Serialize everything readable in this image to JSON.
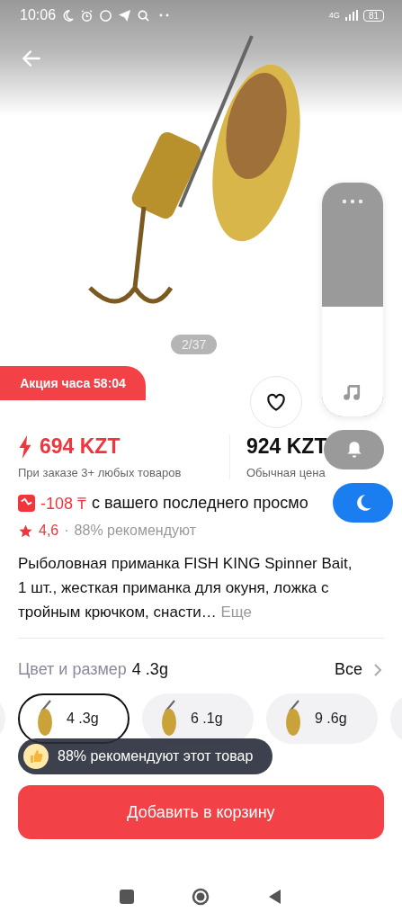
{
  "status_bar": {
    "time": "10:06",
    "network": "4G",
    "battery": "81"
  },
  "gallery": {
    "counter": "2/37"
  },
  "promo": {
    "label": "Акция часа",
    "timer": "58:04"
  },
  "favorite": {
    "selected": false
  },
  "price": {
    "sale": "694 KZT",
    "sale_note": "При заказе 3+ любых товаров",
    "regular": "924 KZT",
    "regular_note": "Обычная цена"
  },
  "price_drop": {
    "amount": "-108 ₸",
    "text": "с вашего последнего просмо"
  },
  "rating": {
    "score": "4,6",
    "separator": "·",
    "recommend": "88% рекомендуют"
  },
  "title": {
    "text": "Рыболовная приманка FISH KING Spinner Bait, 1 шт., жесткая приманка для окуня, ложка с тройным крючком, снасти…",
    "more": "Еще"
  },
  "variants": {
    "label": "Цвет и размер",
    "current": "4 .3g",
    "all": "Все",
    "options": [
      {
        "label": "4 .3g",
        "selected": true
      },
      {
        "label": "6 .1g",
        "selected": false
      },
      {
        "label": "9 .6g",
        "selected": false
      }
    ]
  },
  "toast": {
    "text": "88% рекомендуют этот товар"
  },
  "cart_button": {
    "label": "Добавить в корзину"
  },
  "volume": {
    "level": 0.47
  }
}
